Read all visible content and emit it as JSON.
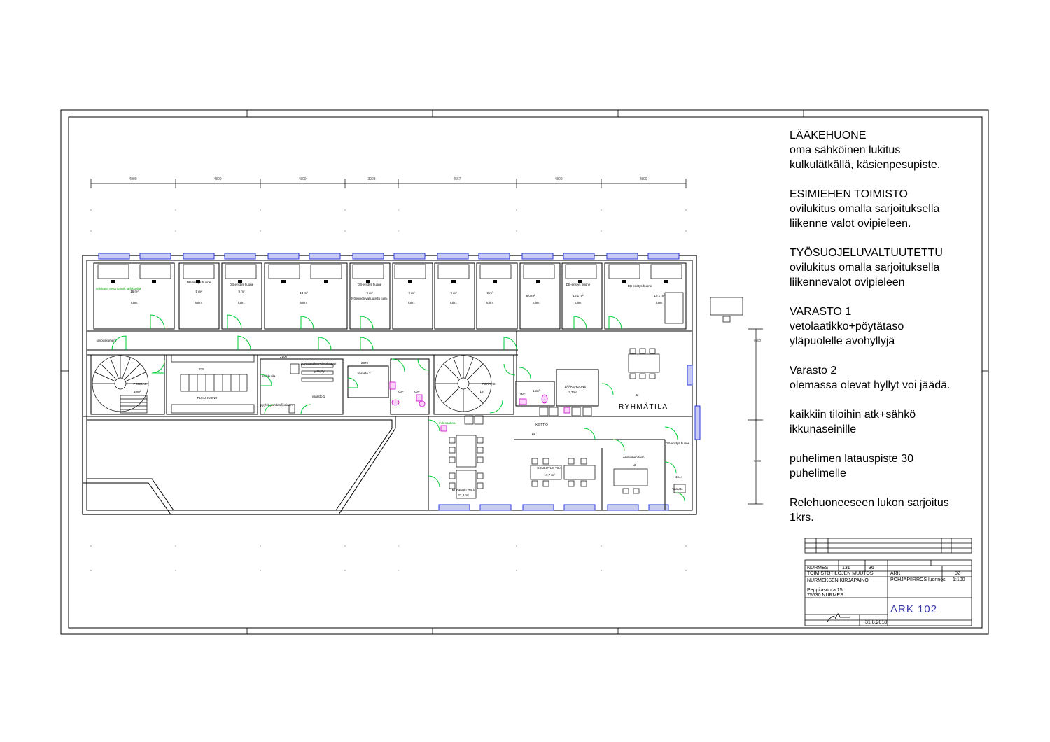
{
  "dimensions": [
    "4800",
    "4800",
    "4800",
    "3023",
    "4567",
    "4800",
    "4800"
  ],
  "rooms": [
    {
      "name": "",
      "area": "16 m²",
      "use": "toim."
    },
    {
      "name": "DB-eristys huone",
      "area": "9 m²",
      "use": "toim."
    },
    {
      "name": "DB-eristys huone",
      "area": "9 m²",
      "use": "toim."
    },
    {
      "name": "",
      "area": "18 m²",
      "use": "toim."
    },
    {
      "name": "DB-eristys huone",
      "area": "9 m²",
      "use": "työsuojeluvaltuutettu toim."
    },
    {
      "name": "",
      "area": "9 m²",
      "use": "toim."
    },
    {
      "name": "",
      "area": "9 m²",
      "use": "toim."
    },
    {
      "name": "",
      "area": "9 m²",
      "use": "toim."
    },
    {
      "name": "",
      "area": "8,0 m²",
      "use": "toim."
    },
    {
      "name": "DB-eristys huone",
      "area": "10,1 m²",
      "use": "toim."
    },
    {
      "name": "DB-eristys huone",
      "area": "10,1 m²",
      "use": "toim."
    }
  ],
  "plan_labels": {
    "porras_left": "PORRAS",
    "porras_left_area": "19m²",
    "porras_mid": "PORRAS",
    "porras_mid_area": "19",
    "pukuhuone": "PUKUHUONE",
    "pukuhuone_dim": "225",
    "suihkutila": "suihkutila",
    "poytalaatikko": "pöytälaatikko+tietokaappi",
    "ylahyllyt": "ylähyllyt",
    "varasto1": "varasto 1",
    "varasto2": "Varasto 2",
    "puhelin": "pyykit/ puhdas/likainen",
    "siivous": "siivouskomero",
    "wc1": "WC",
    "wc2": "WC",
    "wc3": "WC",
    "wc3_area": "14m²",
    "laakehuone": "LÄÄKEHUONE",
    "laakehuone_area": "3,7m²",
    "keittio": "KEITTIÖ",
    "keittio_area": "14",
    "ryhmatila": "RYHMÄTILA",
    "ryhmatila_area": "42",
    "koulutus": "KOULUTUS TILA",
    "koulutus_area": "17,7 m²",
    "ruokailutila": "RUOKAILUTILA",
    "ruokailutila_area": "22,3 m²",
    "esimies": "esimiehen toim.",
    "esimies_area": "12",
    "db_bottom": "DB-eristys huone",
    "varasto_small": "Varasto",
    "green_note": "valokaari sekä anturit ja liikkeiltä",
    "green_note2": "mikroaaltoru",
    "dim_2100": "2100",
    "dim_2370": "2370",
    "dim_1544": "1544",
    "dim_side_top": "9700",
    "dim_side_bottom": "5800"
  },
  "notes": [
    {
      "lines": [
        "LÄÄKEHUONE",
        "oma sähköinen lukitus",
        "kulkulätkällä, käsienpesupiste."
      ]
    },
    {
      "lines": [
        "ESIMIEHEN TOIMISTO",
        "ovilukitus omalla sarjoituksella",
        "liikenne valot ovipieleen."
      ]
    },
    {
      "lines": [
        "TYÖSUOJELUVALTUUTETTU",
        "ovilukitus omalla sarjoituksella",
        "liikennevalot ovipieleen"
      ]
    },
    {
      "lines": [
        "VARASTO 1",
        "vetolaatikko+pöytätaso",
        "yläpuolelle avohyllyjä"
      ]
    },
    {
      "lines": [
        "Varasto 2",
        "olemassa olevat hyllyt voi jäädä."
      ]
    },
    {
      "lines": [
        "kaikkiin tiloihin atk+sähkö",
        "ikkunaseinille"
      ]
    },
    {
      "lines": [
        "puhelimen latauspiste 30",
        "puhelimelle"
      ]
    },
    {
      "lines": [
        "Relehuoneeseen lukon sarjoitus",
        "1krs."
      ]
    }
  ],
  "title_block": {
    "place": "NURMES",
    "block": "131",
    "lot": "36",
    "project": "TOIMISTOTILOJEN MUUTOS",
    "client": "NURMEKSEN KIRJAPAINO",
    "address": "Peppilasuora 15",
    "postal": "75530  NURMES",
    "discipline": "ARK",
    "drawing_no_small": "02",
    "content": "POHJAPIIRROS  luonnos",
    "scale": "1:100",
    "drawing_code": "ARK  102",
    "date": "31.8.2018"
  },
  "colors": {
    "line": "#000000",
    "door": "#00cc33",
    "window": "#2d3ad8",
    "fixture": "#cc00cc",
    "green_text": "#00aa00"
  }
}
